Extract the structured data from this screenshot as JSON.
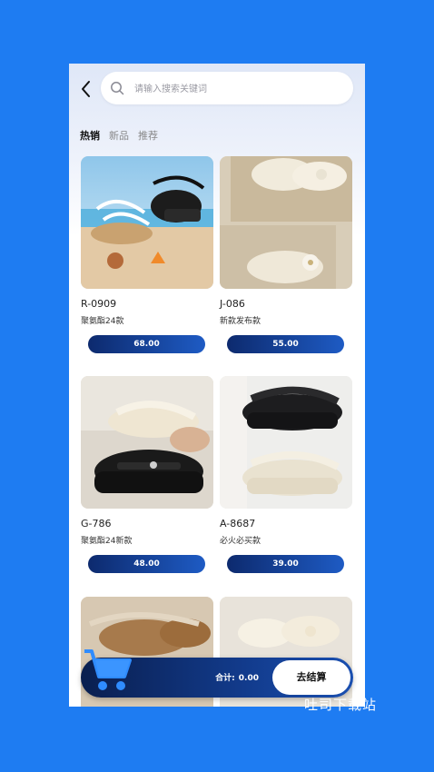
{
  "search": {
    "placeholder": "请输入搜索关键词"
  },
  "tabs": [
    {
      "label": "热销"
    },
    {
      "label": "新品"
    },
    {
      "label": "推荐"
    }
  ],
  "products": [
    {
      "code": "R-0909",
      "name": "聚氨酯24款",
      "price": "68.00"
    },
    {
      "code": "J-086",
      "name": "新款发布款",
      "price": "55.00"
    },
    {
      "code": "G-786",
      "name": "聚氨酯24新款",
      "price": "48.00"
    },
    {
      "code": "A-8687",
      "name": "必火必买款",
      "price": "39.00"
    }
  ],
  "cart": {
    "total_label": "合计:",
    "total_value": "0.00",
    "checkout_label": "去结算"
  },
  "watermark": "吐司下载站",
  "colors": {
    "background": "#1e7cf2",
    "accent_dark": "#0d2a6e",
    "accent_light": "#1e5bc4"
  }
}
